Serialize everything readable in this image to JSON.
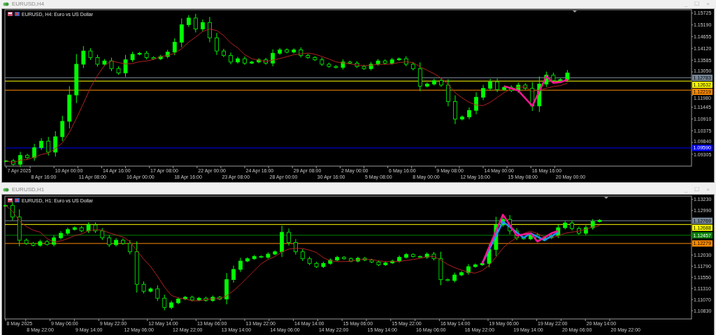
{
  "windows": [
    {
      "title": "EURUSD,H4",
      "controls": [
        "_",
        "☐",
        "×"
      ],
      "chart": {
        "header": "EURUSD, H4: Euro vs US Dollar",
        "price_axis": [
          "1.15725",
          "1.15190",
          "1.14655",
          "1.14120",
          "1.13585",
          "1.13050",
          "1.11980",
          "1.11445",
          "1.10910",
          "1.10375",
          "1.09840",
          "1.09305"
        ],
        "time_axis": [
          "7 Apr 2025",
          "8 Apr 16:00",
          "10 Apr 00:00",
          "11 Apr 08:00",
          "14 Apr 16:00",
          "16 Apr 00:00",
          "17 Apr 08:00",
          "18 Apr 16:00",
          "22 Apr 00:00",
          "23 Apr 08:00",
          "24 Apr 16:00",
          "28 Apr 00:00",
          "29 Apr 08:00",
          "30 Apr 16:00",
          "2 May 00:00",
          "5 May 08:00",
          "6 May 16:00",
          "8 May 00:00",
          "9 May 08:00",
          "12 May 16:00",
          "14 May 00:00",
          "15 May 08:00",
          "16 May 16:00",
          "20 May 00:00"
        ],
        "price_tags": [
          {
            "label": "1.12783",
            "color": "#778899"
          },
          {
            "label": "1.12632",
            "color": "#ffff00"
          },
          {
            "label": "1.12219",
            "color": "#ff8c00"
          },
          {
            "label": "1.09590",
            "color": "#0000ff"
          }
        ]
      }
    },
    {
      "title": "EURUSD,H1",
      "controls": [
        "_",
        "☐",
        "×"
      ],
      "chart": {
        "header": "EURUSD, H1: Euro vs US Dollar",
        "price_axis": [
          "1.13230",
          "1.12990",
          "1.12030",
          "1.11790",
          "1.11550",
          "1.11310",
          "1.11070",
          "1.10830"
        ],
        "time_axis": [
          "8 May 2025",
          "8 May 22:00",
          "9 May 06:00",
          "9 May 14:00",
          "9 May 22:00",
          "12 May 06:00",
          "12 May 14:00",
          "12 May 22:00",
          "13 May 06:00",
          "13 May 14:00",
          "13 May 22:00",
          "14 May 06:00",
          "14 May 14:00",
          "14 May 22:00",
          "15 May 06:00",
          "15 May 14:00",
          "15 May 22:00",
          "16 May 06:00",
          "16 May 14:00",
          "16 May 22:00",
          "19 May 06:00",
          "19 May 14:00",
          "19 May 22:00",
          "20 May 06:00",
          "20 May 14:00",
          "20 May 22:00"
        ],
        "price_tags": [
          {
            "label": "1.12769",
            "color": "#778899"
          },
          {
            "label": "1.12688",
            "color": "#ffff00"
          },
          {
            "label": "1.12457",
            "color": "#008000"
          },
          {
            "label": "1.12279",
            "color": "#ff8c00"
          }
        ]
      }
    }
  ]
}
